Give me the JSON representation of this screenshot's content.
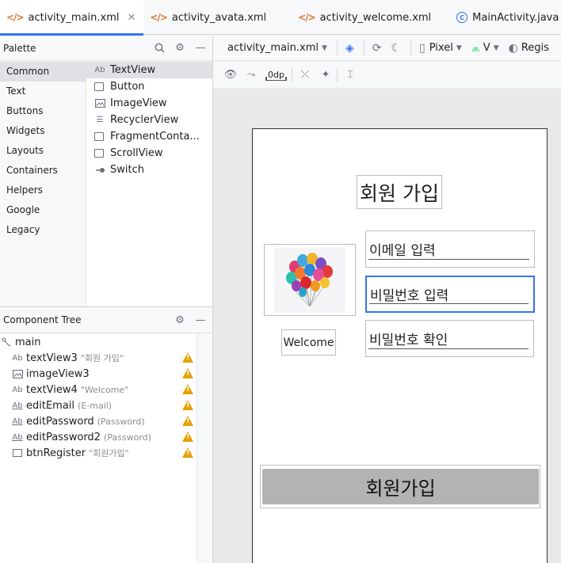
{
  "tabs": [
    {
      "label": "activity_main.xml",
      "icon": "xml-icon",
      "active": true
    },
    {
      "label": "activity_avata.xml",
      "icon": "xml-icon"
    },
    {
      "label": "activity_welcome.xml",
      "icon": "xml-icon"
    },
    {
      "label": "MainActivity.java",
      "icon": "java-class-icon"
    }
  ],
  "palette": {
    "title": "Palette",
    "categories": [
      "Common",
      "Text",
      "Buttons",
      "Widgets",
      "Layouts",
      "Containers",
      "Helpers",
      "Google",
      "Legacy"
    ],
    "selected_category": "Common",
    "widgets": [
      {
        "label": "TextView",
        "icon": "textview-icon"
      },
      {
        "label": "Button",
        "icon": "button-icon"
      },
      {
        "label": "ImageView",
        "icon": "imageview-icon"
      },
      {
        "label": "RecyclerView",
        "icon": "recyclerview-icon"
      },
      {
        "label": "FragmentConta...",
        "icon": "fragment-icon"
      },
      {
        "label": "ScrollView",
        "icon": "scrollview-icon"
      },
      {
        "label": "Switch",
        "icon": "switch-icon"
      }
    ],
    "glyphs": {
      "textview": "Ab"
    }
  },
  "component_tree": {
    "title": "Component Tree",
    "root": "main",
    "nodes": [
      {
        "id": "textView3",
        "hint": "\"회원 가입\"",
        "glyph": "Ab"
      },
      {
        "id": "imageView3",
        "hint": ""
      },
      {
        "id": "textView4",
        "hint": "\"Welcome\"",
        "glyph": "Ab"
      },
      {
        "id": "editEmail",
        "hint": "(E-mail)",
        "glyph": "Ab"
      },
      {
        "id": "editPassword",
        "hint": "(Password)",
        "glyph": "Ab"
      },
      {
        "id": "editPassword2",
        "hint": "(Password)",
        "glyph": "Ab"
      },
      {
        "id": "btnRegister",
        "hint": "\"회원가입\""
      }
    ],
    "warning_color": "#e5a100"
  },
  "design_toolbar": {
    "file": "activity_main.xml",
    "device": "Pixel",
    "api": "V",
    "theme": "Regis"
  },
  "tool_row": {
    "margin": "0dp"
  },
  "preview": {
    "title": "회원 가입",
    "welcome": "Welcome",
    "email_placeholder": "이메일 입력",
    "password_placeholder": "비밀번호 입력",
    "password_confirm_placeholder": "비밀번호 확인",
    "register_button": "회원가입"
  },
  "colors": {
    "accent": "#3574f0",
    "xml_icon": "#e0762c",
    "button_bg": "#b3b3b3"
  }
}
